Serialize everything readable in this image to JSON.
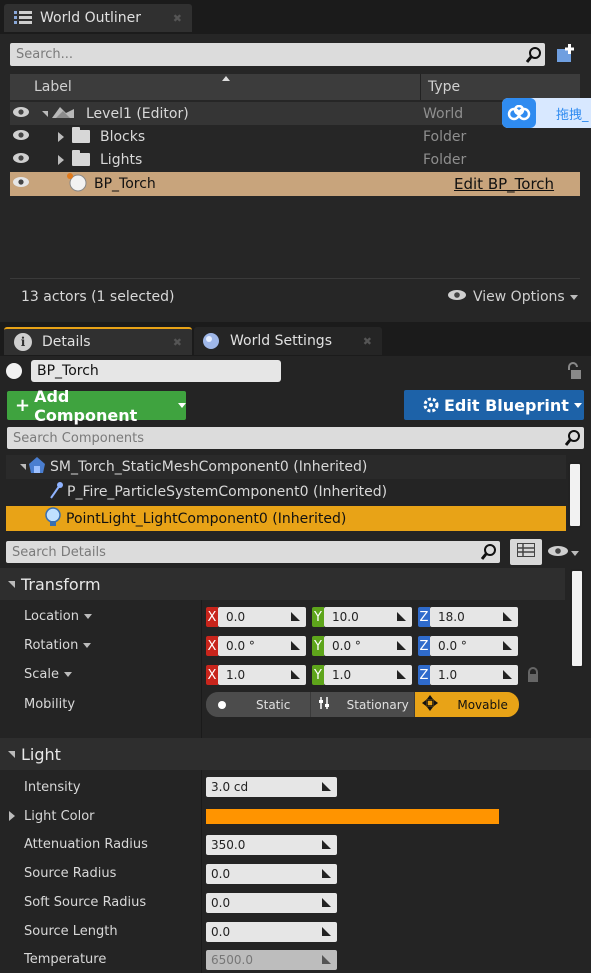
{
  "outliner": {
    "tab_title": "World Outliner",
    "search_placeholder": "Search...",
    "col_label": "Label",
    "col_type": "Type",
    "items": [
      {
        "label": "Level1 (Editor)",
        "type": "World"
      },
      {
        "label": "Blocks",
        "type": "Folder"
      },
      {
        "label": "Lights",
        "type": "Folder"
      },
      {
        "label": "BP_Torch",
        "type": "Edit BP_Torch"
      }
    ],
    "status": "13 actors (1 selected)",
    "view_options": "View Options"
  },
  "overlay_badge": "拖拽_",
  "details": {
    "tab_details": "Details",
    "tab_world_settings": "World Settings",
    "actor_name": "BP_Torch",
    "add_component": "Add Component",
    "edit_blueprint": "Edit Blueprint",
    "search_components_placeholder": "Search Components",
    "components": [
      "SM_Torch_StaticMeshComponent0 (Inherited)",
      "P_Fire_ParticleSystemComponent0 (Inherited)",
      "PointLight_LightComponent0 (Inherited)"
    ],
    "search_details_placeholder": "Search Details"
  },
  "transform": {
    "title": "Transform",
    "location_label": "Location",
    "rotation_label": "Rotation",
    "scale_label": "Scale",
    "mobility_label": "Mobility",
    "axis_x": "X",
    "axis_y": "Y",
    "axis_z": "Z",
    "location": [
      "0.0",
      "10.0",
      "18.0"
    ],
    "rotation": [
      "0.0 °",
      "0.0 °",
      "0.0 °"
    ],
    "scale": [
      "1.0",
      "1.0",
      "1.0"
    ],
    "mobility_options": [
      "Static",
      "Stationary",
      "Movable"
    ],
    "mobility_selected": "Movable"
  },
  "light": {
    "title": "Light",
    "intensity_label": "Intensity",
    "intensity": "3.0 cd",
    "light_color_label": "Light Color",
    "light_color": "#ff9400",
    "attenuation_label": "Attenuation Radius",
    "attenuation": "350.0",
    "source_radius_label": "Source Radius",
    "source_radius": "0.0",
    "soft_source_radius_label": "Soft Source Radius",
    "soft_source_radius": "0.0",
    "source_length_label": "Source Length",
    "source_length": "0.0",
    "temperature_label": "Temperature",
    "temperature": "6500.0"
  },
  "colors": {
    "selected_row": "#c8a47c",
    "selected_component": "#e8a317",
    "add_component_bg": "#3fa33f",
    "edit_blueprint_bg": "#1d62a8",
    "axis_x": "#c8251c",
    "axis_y": "#5ea51b",
    "axis_z": "#2f6bcc"
  }
}
